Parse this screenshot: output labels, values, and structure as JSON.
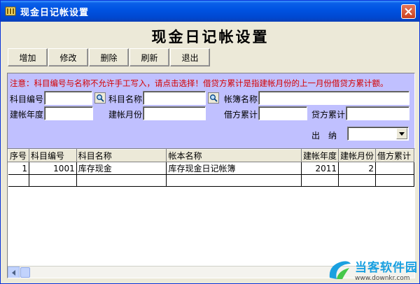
{
  "window": {
    "title": "现金日记帐设置"
  },
  "heading": "现金日记帐设置",
  "toolbar": {
    "add": "增加",
    "edit": "修改",
    "delete": "删除",
    "refresh": "刷新",
    "exit": "退出"
  },
  "form": {
    "notice": "注意：科目编号与名称不允许手工写入，请点击选择！借贷方累计是指建帐月份的上一月份借贷方累计额。",
    "subject_code": {
      "label": "科目编号",
      "value": ""
    },
    "subject_name": {
      "label": "科目名称",
      "value": ""
    },
    "ledger_name": {
      "label": "帐簿名称",
      "value": ""
    },
    "build_year": {
      "label": "建帐年度",
      "value": ""
    },
    "build_month": {
      "label": "建帐月份",
      "value": ""
    },
    "debit_total": {
      "label": "借方累计",
      "value": ""
    },
    "credit_total": {
      "label": "贷方累计",
      "value": ""
    },
    "in_out": {
      "label": "出　纳",
      "value": ""
    }
  },
  "table": {
    "headers": [
      "序号",
      "科目编号",
      "科目名称",
      "帐本名称",
      "建帐年度",
      "建帐月份",
      "借方累计"
    ],
    "rows": [
      [
        "1",
        "1001",
        "库存现金",
        "库存现金日记帐簿",
        "2011",
        "2",
        ""
      ]
    ]
  },
  "watermark": {
    "text": "当客软件园",
    "url": "www.downkr.com"
  }
}
